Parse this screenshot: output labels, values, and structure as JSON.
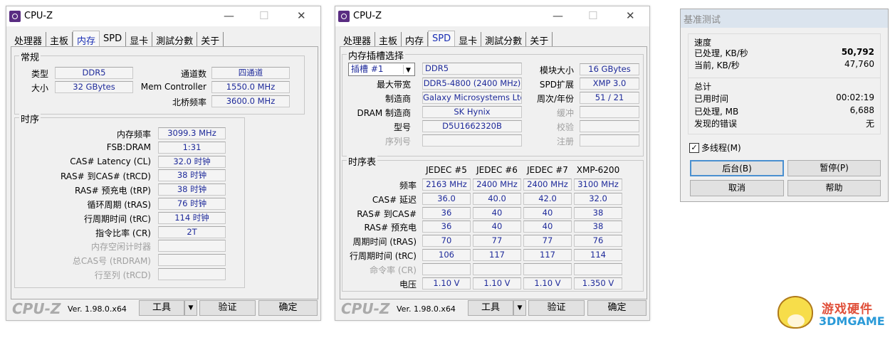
{
  "win1": {
    "title": "CPU-Z",
    "tabs": [
      "处理器",
      "主板",
      "内存",
      "SPD",
      "显卡",
      "測試分數",
      "关于"
    ],
    "active_tab": 2,
    "general": {
      "title": "常规",
      "type_label": "类型",
      "type": "DDR5",
      "size_label": "大小",
      "size": "32 GBytes",
      "channels_label": "通道数",
      "channels": "四通道",
      "memctrl_label": "Mem Controller",
      "memctrl": "1550.0 MHz",
      "nb_label": "北桥频率",
      "nb": "3600.0 MHz"
    },
    "timings": {
      "title": "时序",
      "rows": [
        {
          "label": "内存频率",
          "value": "3099.3 MHz"
        },
        {
          "label": "FSB:DRAM",
          "value": "1:31"
        },
        {
          "label": "CAS# Latency (CL)",
          "value": "32.0 时钟"
        },
        {
          "label": "RAS# 到CAS# (tRCD)",
          "value": "38 时钟"
        },
        {
          "label": "RAS# 预充电 (tRP)",
          "value": "38 时钟"
        },
        {
          "label": "循环周期 (tRAS)",
          "value": "76 时钟"
        },
        {
          "label": "行周期时间 (tRC)",
          "value": "114 时钟"
        },
        {
          "label": "指令比率 (CR)",
          "value": "2T"
        },
        {
          "label": "内存空闲计时器",
          "value": "",
          "disabled": true
        },
        {
          "label": "总CAS号 (tRDRAM)",
          "value": "",
          "disabled": true
        },
        {
          "label": "行至列 (tRCD)",
          "value": "",
          "disabled": true
        }
      ]
    }
  },
  "win2": {
    "title": "CPU-Z",
    "tabs": [
      "处理器",
      "主板",
      "内存",
      "SPD",
      "显卡",
      "測試分數",
      "关于"
    ],
    "active_tab": 3,
    "slot": {
      "title": "内存插槽选择",
      "selected": "插槽 #1",
      "type": "DDR5",
      "left": [
        {
          "label": "最大带宽",
          "value": "DDR5-4800 (2400 MHz)"
        },
        {
          "label": "制造商",
          "value": "Galaxy Microsystems Ltd."
        },
        {
          "label": "DRAM 制造商",
          "value": "SK Hynix"
        },
        {
          "label": "型号",
          "value": "D5U1662320B"
        },
        {
          "label": "序列号",
          "value": "",
          "disabled": true
        }
      ],
      "right": [
        {
          "label": "模块大小",
          "value": "16 GBytes"
        },
        {
          "label": "SPD扩展",
          "value": "XMP 3.0"
        },
        {
          "label": "周次/年份",
          "value": "51 / 21"
        },
        {
          "label": "缓冲",
          "value": "",
          "disabled": true
        },
        {
          "label": "校验",
          "value": "",
          "disabled": true
        },
        {
          "label": "注册",
          "value": "",
          "disabled": true
        }
      ]
    },
    "table": {
      "title": "时序表",
      "columns": [
        "JEDEC #5",
        "JEDEC #6",
        "JEDEC #7",
        "XMP-6200"
      ],
      "rows": [
        {
          "label": "频率",
          "values": [
            "2163 MHz",
            "2400 MHz",
            "2400 MHz",
            "3100 MHz"
          ]
        },
        {
          "label": "CAS# 延迟",
          "values": [
            "36.0",
            "40.0",
            "42.0",
            "32.0"
          ]
        },
        {
          "label": "RAS# 到CAS#",
          "values": [
            "36",
            "40",
            "40",
            "38"
          ]
        },
        {
          "label": "RAS# 预充电",
          "values": [
            "36",
            "40",
            "40",
            "38"
          ]
        },
        {
          "label": "周期时间 (tRAS)",
          "values": [
            "70",
            "77",
            "77",
            "76"
          ]
        },
        {
          "label": "行周期时间 (tRC)",
          "values": [
            "106",
            "117",
            "117",
            "114"
          ]
        },
        {
          "label": "命令率 (CR)",
          "values": [
            "",
            "",
            "",
            ""
          ],
          "disabled": true
        },
        {
          "label": "电压",
          "values": [
            "1.10 V",
            "1.10 V",
            "1.10 V",
            "1.350 V"
          ]
        }
      ]
    }
  },
  "bottom": {
    "logo": "CPU-Z",
    "version": "Ver. 1.98.0.x64",
    "tools": "工具",
    "validate": "验证",
    "ok": "确定"
  },
  "bench": {
    "title": "基准测试",
    "speed": {
      "title": "速度",
      "rows": [
        {
          "label": "已处理, KB/秒",
          "value": "50,792"
        },
        {
          "label": "当前, KB/秒",
          "value": "47,760"
        }
      ]
    },
    "total": {
      "title": "总计",
      "rows": [
        {
          "label": "已用时间",
          "value": "00:02:19"
        },
        {
          "label": "已处理, MB",
          "value": "6,688"
        },
        {
          "label": "发现的错误",
          "value": "无"
        }
      ]
    },
    "multithread": "多线程(M)",
    "multithread_checked": true,
    "buttons": [
      "后台(B)",
      "暂停(P)",
      "取消",
      "帮助"
    ]
  },
  "watermark": {
    "line1": "游戏硬件",
    "line2": "3DMGAME"
  }
}
